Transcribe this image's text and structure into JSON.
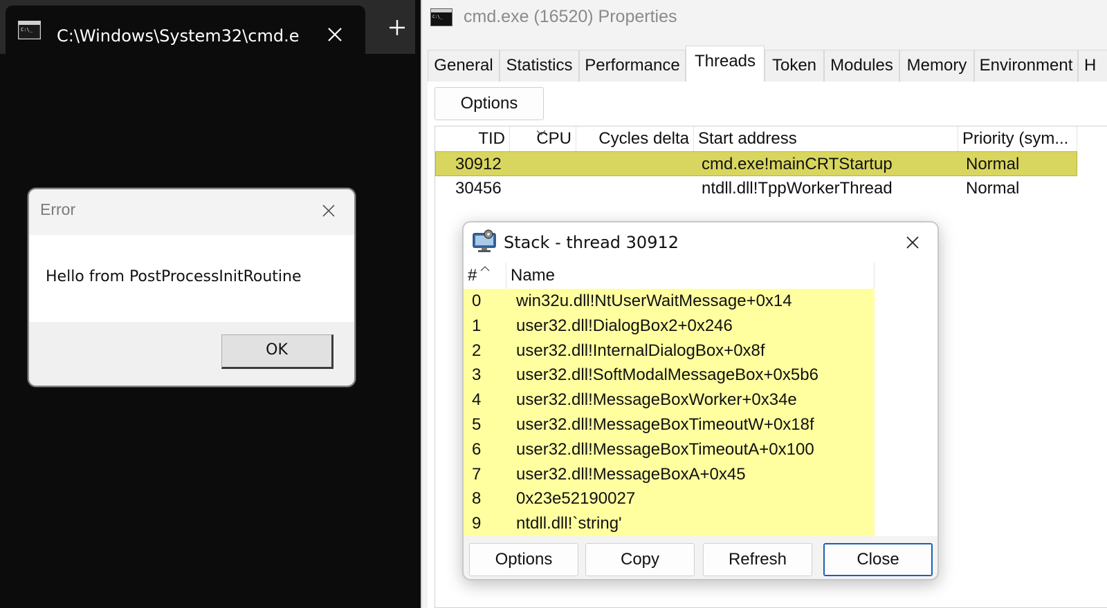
{
  "terminal": {
    "tab_title": "C:\\Windows\\System32\\cmd.e",
    "tab_icon": "cmd-icon",
    "close_icon": "close-icon",
    "new_tab_icon": "plus-icon"
  },
  "error_box": {
    "title": "Error",
    "message": "Hello from PostProcessInitRoutine",
    "ok_label": "OK"
  },
  "properties": {
    "title": "cmd.exe (16520) Properties",
    "tabs": [
      "General",
      "Statistics",
      "Performance",
      "Threads",
      "Token",
      "Modules",
      "Memory",
      "Environment",
      "H"
    ],
    "active_tab": "Threads",
    "options_label": "Options",
    "threads": {
      "columns": [
        "TID",
        "CPU",
        "Cycles delta",
        "Start address",
        "Priority (sym..."
      ],
      "rows": [
        {
          "tid": "30912",
          "cpu": "",
          "cycles": "",
          "start": "cmd.exe!mainCRTStartup",
          "priority": "Normal",
          "selected": true
        },
        {
          "tid": "30456",
          "cpu": "",
          "cycles": "",
          "start": "ntdll.dll!TppWorkerThread",
          "priority": "Normal",
          "selected": false
        }
      ]
    }
  },
  "stack_dialog": {
    "title": "Stack - thread 30912",
    "columns": [
      "#",
      "Name"
    ],
    "frames": [
      {
        "n": "0",
        "name": "win32u.dll!NtUserWaitMessage+0x14"
      },
      {
        "n": "1",
        "name": "user32.dll!DialogBox2+0x246"
      },
      {
        "n": "2",
        "name": "user32.dll!InternalDialogBox+0x8f"
      },
      {
        "n": "3",
        "name": "user32.dll!SoftModalMessageBox+0x5b6"
      },
      {
        "n": "4",
        "name": "user32.dll!MessageBoxWorker+0x34e"
      },
      {
        "n": "5",
        "name": "user32.dll!MessageBoxTimeoutW+0x18f"
      },
      {
        "n": "6",
        "name": "user32.dll!MessageBoxTimeoutA+0x100"
      },
      {
        "n": "7",
        "name": "user32.dll!MessageBoxA+0x45"
      },
      {
        "n": "8",
        "name": "0x23e52190027"
      },
      {
        "n": "9",
        "name": "ntdll.dll!`string'"
      }
    ],
    "buttons": {
      "options": "Options",
      "copy": "Copy",
      "refresh": "Refresh",
      "close": "Close"
    }
  },
  "colors": {
    "selected_row": "#d9d65f",
    "stack_highlight": "#ffffa0",
    "terminal_bg": "#0c0c0c",
    "default_button_border": "#1a5fb4"
  }
}
